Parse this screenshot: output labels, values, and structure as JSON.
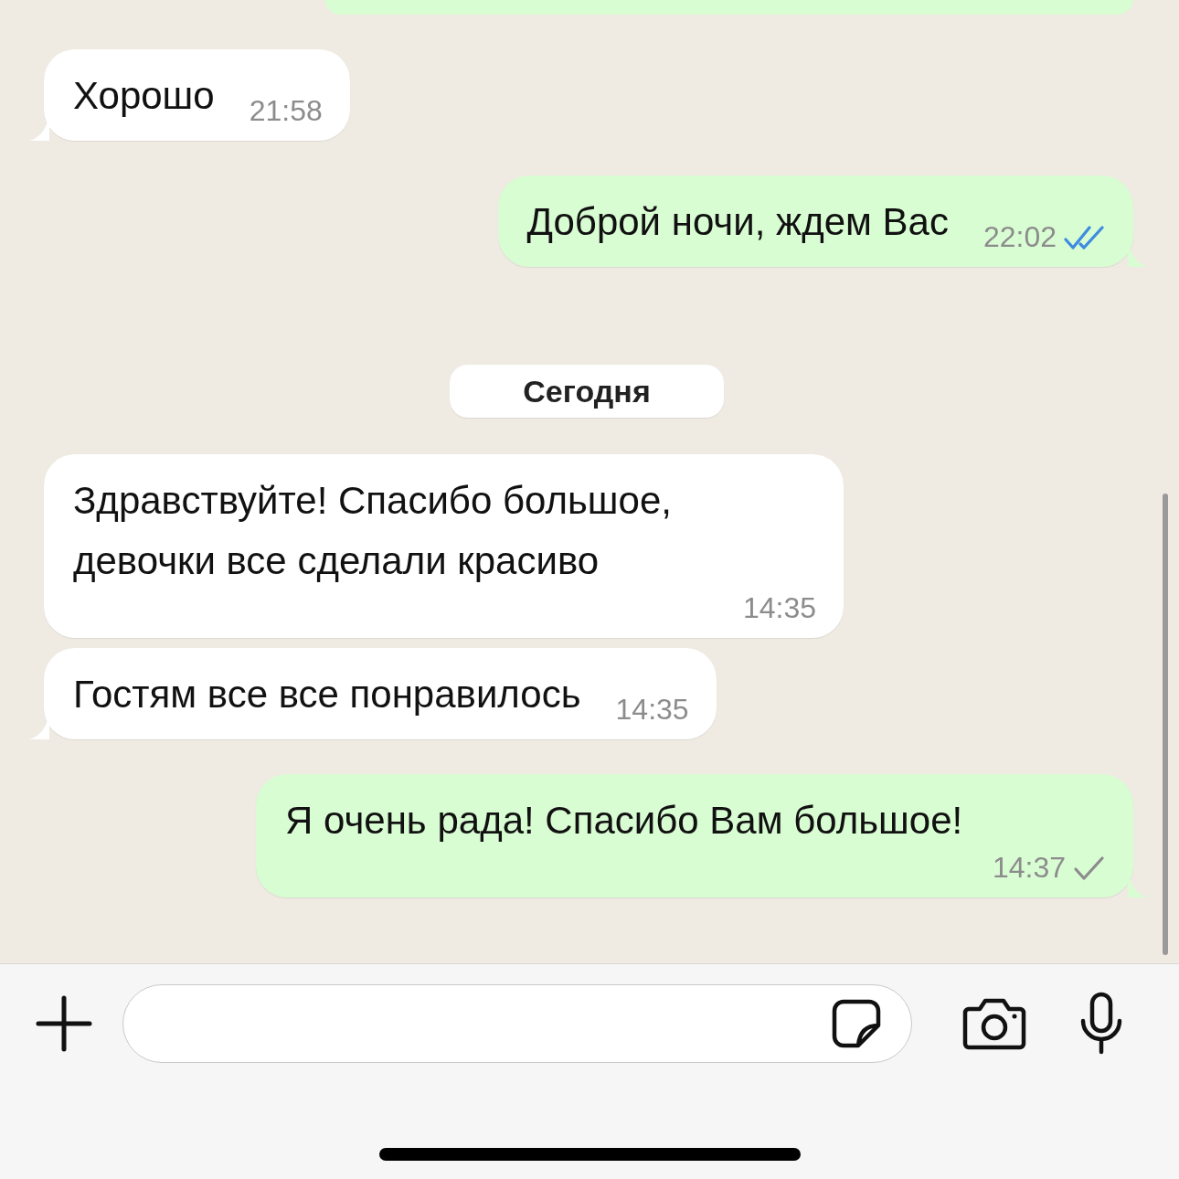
{
  "messages": [
    {
      "kind": "fragment",
      "outgoing": true,
      "tail": false
    },
    {
      "kind": "text",
      "outgoing": false,
      "text": "Хорошо",
      "time": "21:58",
      "tail": true
    },
    {
      "kind": "text",
      "outgoing": true,
      "text": "Доброй ночи, ждем Вас",
      "time": "22:02",
      "read": true,
      "tail": true
    },
    {
      "kind": "date",
      "text": "Сегодня"
    },
    {
      "kind": "text",
      "outgoing": false,
      "text": "Здравствуйте! Спасибо большое, девочки все сделали красиво",
      "time": "14:35",
      "tail": false
    },
    {
      "kind": "text",
      "outgoing": false,
      "text": "Гостям все все понравилось",
      "time": "14:35",
      "tail": true
    },
    {
      "kind": "text",
      "outgoing": true,
      "text": "Я очень рада! Спасибо Вам большое!",
      "time": "14:37",
      "read": false,
      "tail": true
    }
  ]
}
